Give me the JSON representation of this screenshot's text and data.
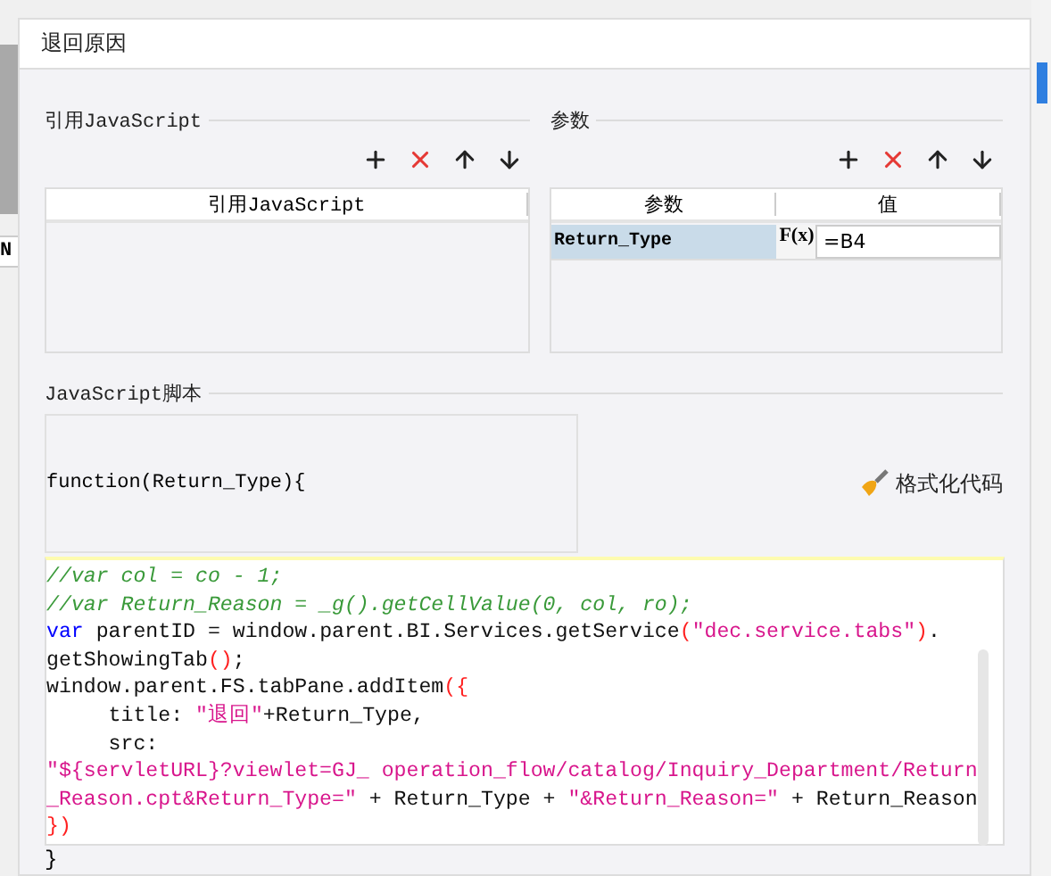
{
  "background": {
    "sheet_cell_text": "N"
  },
  "dialog": {
    "title": "退回原因"
  },
  "js_refs": {
    "legend": "引用JavaScript",
    "columns": [
      "引用JavaScript"
    ]
  },
  "params": {
    "legend": "参数",
    "columns": [
      "参数",
      "值"
    ],
    "rows": [
      {
        "name": "Return_Type",
        "formula_label": "F(x)",
        "value": "=B4",
        "selected": true
      }
    ]
  },
  "script": {
    "legend": "JavaScript脚本",
    "signature": "function(Return_Type){",
    "format_button": "格式化代码",
    "lines": [
      [
        {
          "kind": "comment",
          "text": "//var col = co - 1;"
        }
      ],
      [
        {
          "kind": "comment",
          "text": "//var Return_Reason = _g().getCellValue(0, col, ro);"
        }
      ],
      [
        {
          "kind": "keyword",
          "text": "var"
        },
        {
          "kind": "plain",
          "text": " parentID = window.parent.BI.Services.getService"
        },
        {
          "kind": "paren",
          "text": "("
        },
        {
          "kind": "string",
          "text": "\"dec.service.tabs\""
        },
        {
          "kind": "paren",
          "text": ")"
        },
        {
          "kind": "plain",
          "text": "."
        }
      ],
      [
        {
          "kind": "plain",
          "text": "getShowingTab"
        },
        {
          "kind": "paren",
          "text": "()"
        },
        {
          "kind": "plain",
          "text": ";"
        }
      ],
      [
        {
          "kind": "plain",
          "text": "window.parent.FS.tabPane.addItem"
        },
        {
          "kind": "paren",
          "text": "({"
        }
      ],
      [
        {
          "kind": "plain",
          "text": "     title: "
        },
        {
          "kind": "string",
          "text": "\"退回\""
        },
        {
          "kind": "plain",
          "text": "+Return_Type,"
        }
      ],
      [
        {
          "kind": "plain",
          "text": "     src:"
        }
      ],
      [
        {
          "kind": "string",
          "text": "\"${servletURL}?viewlet=GJ_ operation_flow/catalog/Inquiry_Department/Return"
        }
      ],
      [
        {
          "kind": "string",
          "text": "_Reason.cpt&Return_Type=\""
        },
        {
          "kind": "plain",
          "text": " + Return_Type + "
        },
        {
          "kind": "string",
          "text": "\"&Return_Reason=\""
        },
        {
          "kind": "plain",
          "text": " + Return_Reason"
        }
      ],
      [
        {
          "kind": "paren",
          "text": "})"
        }
      ]
    ],
    "closing": "}"
  }
}
